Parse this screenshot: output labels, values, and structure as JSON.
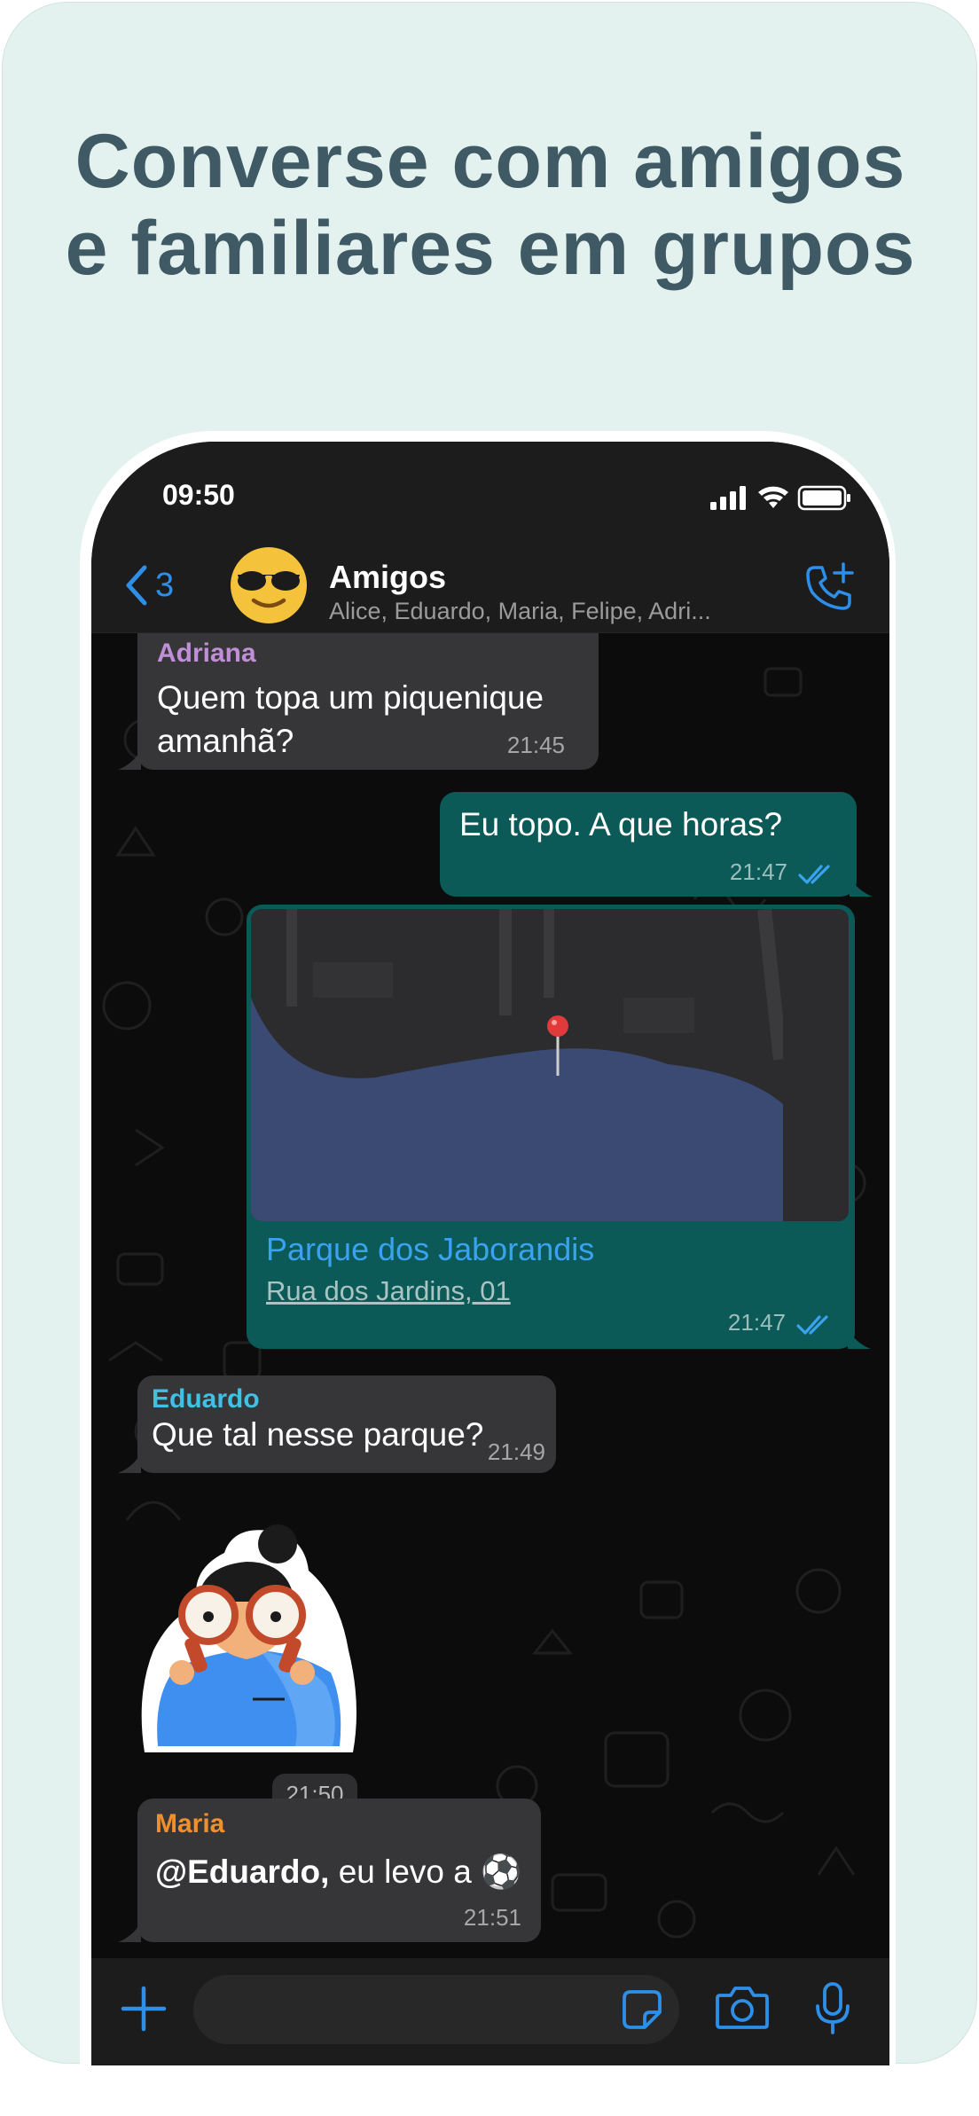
{
  "headline": {
    "line1": "Converse com amigos",
    "line2": "e familiares em grupos"
  },
  "status_bar": {
    "time": "09:50",
    "icons": [
      "signal-icon",
      "wifi-icon",
      "battery-icon"
    ]
  },
  "chat_header": {
    "back_count": "3",
    "group_name": "Amigos",
    "members": "Alice, Eduardo, Maria, Felipe, Adri...",
    "avatar_icon": "sunglasses-emoji-icon",
    "call_icon": "add-call-icon"
  },
  "messages": [
    {
      "sender": "Adriana",
      "text_line1": "Quem topa um piquenique",
      "text_line2": "amanhã?",
      "time": "21:45",
      "sender_color": "#c08fd6"
    },
    {
      "sender": "",
      "text": "Eu topo. A que horas?",
      "time": "21:47",
      "status": "read"
    },
    {
      "sender": "",
      "type": "location",
      "title": "Parque dos Jaborandis",
      "address": "Rua dos Jardins, 01",
      "time": "21:47",
      "status": "read"
    },
    {
      "sender": "Eduardo",
      "text": "Que tal nesse parque?",
      "time": "21:49",
      "sender_color": "#3fc1e6"
    },
    {
      "sender": "",
      "type": "sticker",
      "sticker": "binoculars-person-sticker",
      "time": "21:50"
    },
    {
      "sender": "Maria",
      "mention": "@Eduardo,",
      "text": " eu levo a ⚽",
      "time": "21:51",
      "sender_color": "#f0902c"
    }
  ],
  "composer": {
    "icons": [
      "plus-icon",
      "sticker-icon",
      "camera-icon",
      "microphone-icon"
    ]
  },
  "colors": {
    "background": "#e3f2ee",
    "headline": "#3f5a64",
    "accent": "#2d8fe8",
    "outgoing_bubble": "#0b5a57",
    "incoming_bubble": "#363638"
  }
}
